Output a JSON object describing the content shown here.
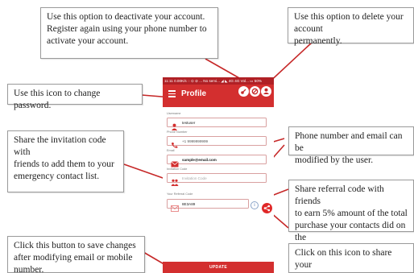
{
  "callouts": {
    "deactivate": "Use this option to deactivate your account.\nRegister again using your phone number to\nactivate your account.",
    "delete": "Use this option to delete your account\npermanently.",
    "change_password": "Use this icon to change password.",
    "invitation": "Share the invitation code with\nfriends to add them to your\nemergency contact list.",
    "phone_email": "Phone number and email can be\nmodified by the user.",
    "referral": "Share referral code with friends\nto earn 5% amount of the total\npurchase your contacts did on the\nHOC app.",
    "save": "Click this button to save changes\nafter modifying email or mobile\nnumber.",
    "share_icon": "Click on this icon to share your\nreferral code with your contacts."
  },
  "phone": {
    "status_bar": "11:11  0.00K/s ◌ ⊙ ⊘   ... No servi...  ◢ ◣ 4G  4G  Vol...  ▭ 50%",
    "title": "Profile",
    "actions": {
      "change_password_icon": "lock-key-icon",
      "deactivate_icon": "deactivate-icon",
      "delete_icon": "delete-user-icon"
    },
    "form": {
      "username_label": "Username",
      "username_value": "testuser",
      "phone_label": "Phone Number",
      "phone_value": "+1  9999999999",
      "email_label": "Email",
      "email_value": "sample@email.com",
      "invitation_label": "Invitation Code",
      "invitation_placeholder": "Invitation Code",
      "referral_label": "Your Referral Code",
      "referral_value": "8E3A89"
    },
    "update_button": "UPDATE"
  },
  "colors": {
    "primary": "#d32f2f",
    "status_bar": "#b02025",
    "connector": "#c62828"
  }
}
